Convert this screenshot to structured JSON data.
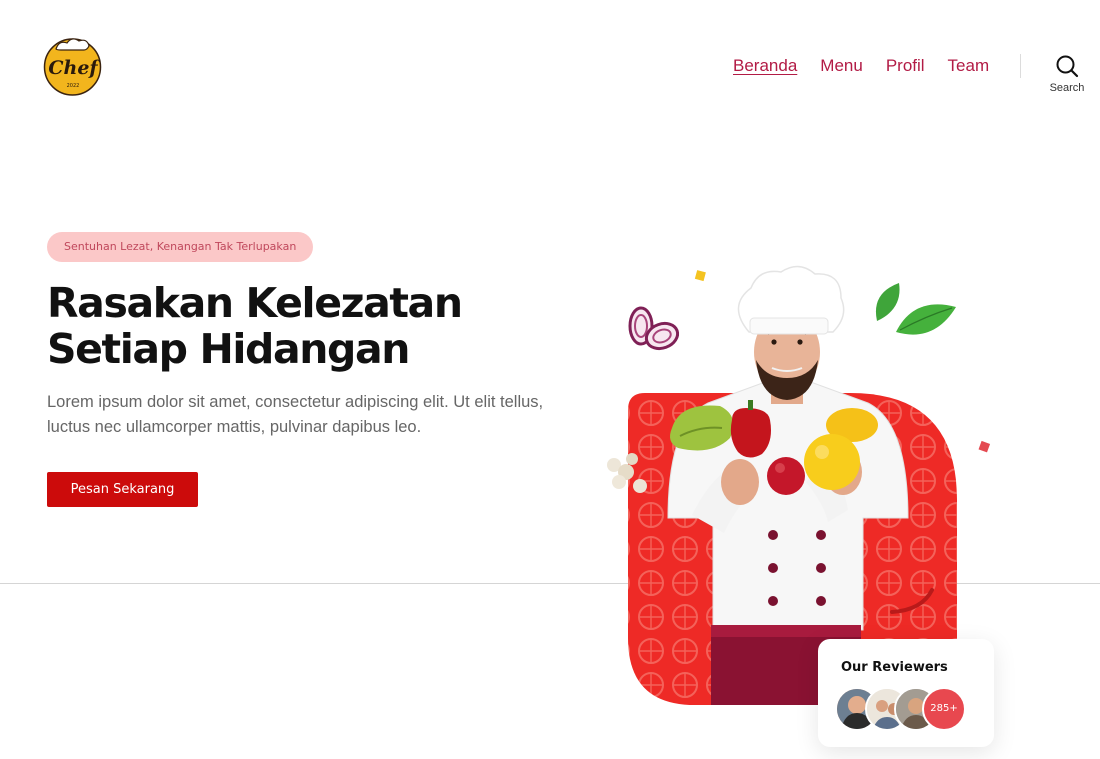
{
  "brand": {
    "logo_text": "Chef",
    "logo_year": "2022"
  },
  "nav": {
    "items": [
      {
        "label": "Beranda",
        "active": true
      },
      {
        "label": "Menu",
        "active": false
      },
      {
        "label": "Profil",
        "active": false
      },
      {
        "label": "Team",
        "active": false
      }
    ],
    "search_label": "Search"
  },
  "hero": {
    "tagline": "Sentuhan Lezat, Kenangan Tak Terlupakan",
    "headline_line1": "Rasakan Kelezatan",
    "headline_line2": "Setiap Hidangan",
    "description": "Lorem ipsum dolor sit amet, consectetur adipiscing elit. Ut elit tellus, luctus nec ullamcorper mattis, pulvinar dapibus leo.",
    "cta_label": "Pesan Sekarang"
  },
  "reviewers": {
    "title": "Our Reviewers",
    "count": "285+"
  },
  "colors": {
    "accent_red": "#cc0b0b",
    "nav_link": "#b21b45",
    "pill_bg": "#fbc8c8",
    "badge_red": "#e8484f"
  }
}
